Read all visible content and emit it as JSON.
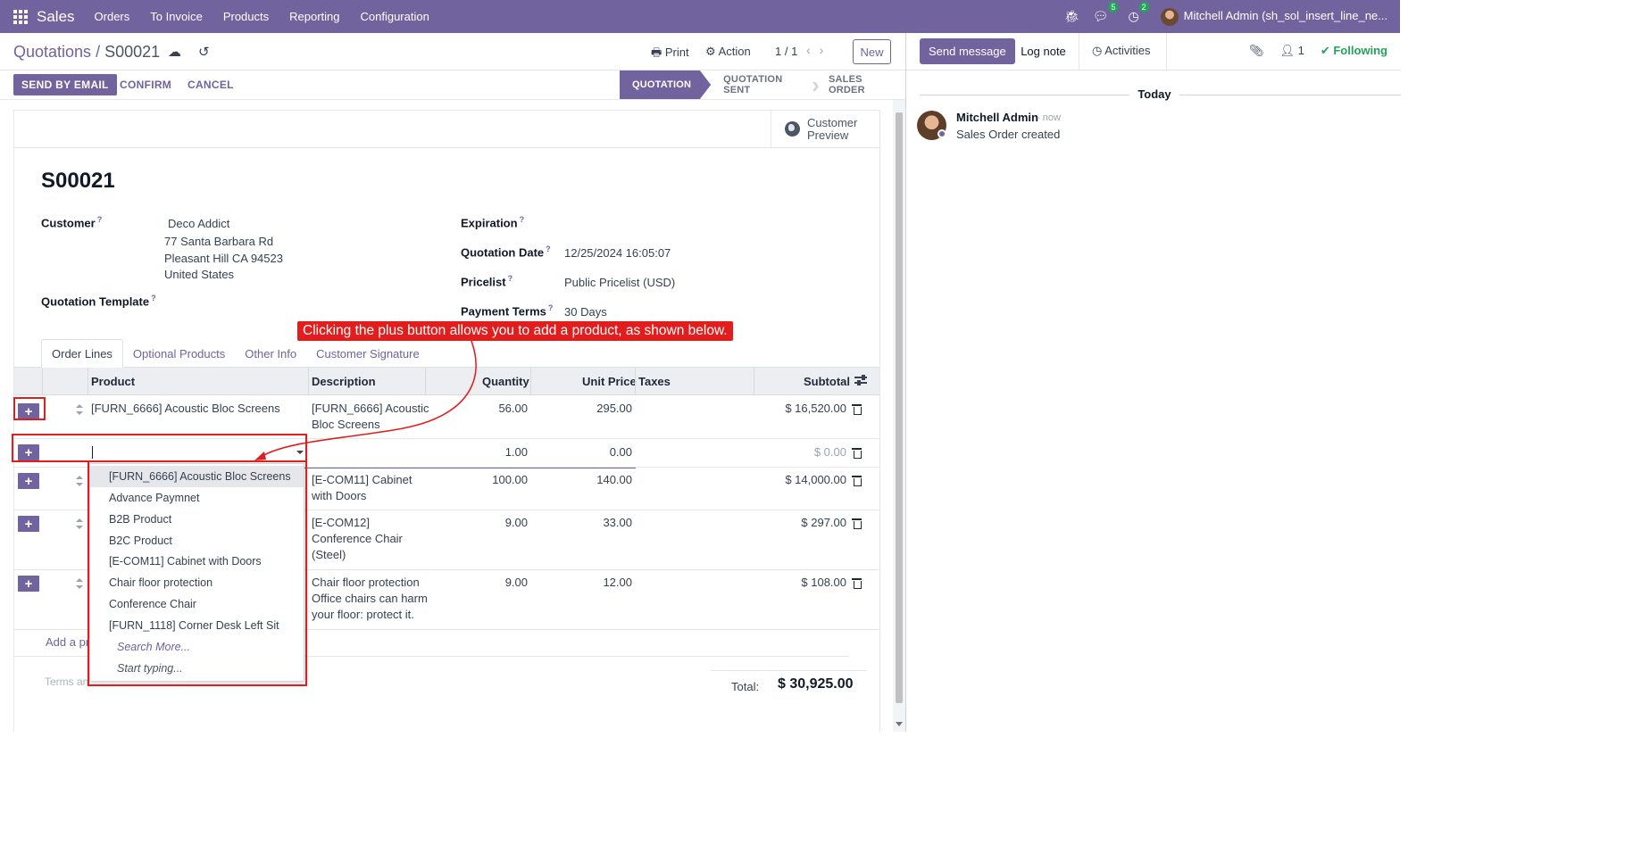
{
  "nav": {
    "brand": "Sales",
    "items": [
      "Orders",
      "To Invoice",
      "Products",
      "Reporting",
      "Configuration"
    ],
    "messages_badge": "5",
    "activities_badge": "2",
    "user": "Mitchell Admin (sh_sol_insert_line_ne..."
  },
  "control_panel": {
    "breadcrumb_parent": "Quotations",
    "breadcrumb_sep": "/",
    "breadcrumb_current": "S00021",
    "print": "Print",
    "action": "Action",
    "pager": "1 / 1",
    "new": "New"
  },
  "statusbar": {
    "send_by_email": "SEND BY EMAIL",
    "confirm": "CONFIRM",
    "cancel": "CANCEL",
    "stages": [
      "QUOTATION",
      "QUOTATION SENT",
      "SALES ORDER"
    ]
  },
  "form": {
    "customer_preview": "Customer Preview",
    "record_name": "S00021",
    "customer_label": "Customer",
    "customer_name": "Deco Addict",
    "customer_address": [
      "77 Santa Barbara Rd",
      "Pleasant Hill CA 94523",
      "United States"
    ],
    "quotation_template_label": "Quotation Template",
    "expiration_label": "Expiration",
    "quotation_date_label": "Quotation Date",
    "quotation_date": "12/25/2024 16:05:07",
    "pricelist_label": "Pricelist",
    "pricelist": "Public Pricelist (USD)",
    "payment_terms_label": "Payment Terms",
    "payment_terms": "30 Days",
    "help_marker": "?"
  },
  "tabs": [
    "Order Lines",
    "Optional Products",
    "Other Info",
    "Customer Signature"
  ],
  "table": {
    "headers": {
      "product": "Product",
      "description": "Description",
      "quantity": "Quantity",
      "unit_price": "Unit Price",
      "taxes": "Taxes",
      "subtotal": "Subtotal"
    },
    "rows": [
      {
        "product": "[FURN_6666] Acoustic Bloc Screens",
        "description": [
          "[FURN_6666] Acoustic",
          "Bloc Screens"
        ],
        "quantity": "56.00",
        "unit_price": "295.00",
        "subtotal": "$ 16,520.00"
      },
      {
        "product": "",
        "description": [],
        "quantity": "1.00",
        "unit_price": "0.00",
        "subtotal": "$ 0.00"
      },
      {
        "product": "",
        "description": [
          "[E-COM11] Cabinet",
          "with Doors"
        ],
        "quantity": "100.00",
        "unit_price": "140.00",
        "subtotal": "$ 14,000.00"
      },
      {
        "product": "",
        "description": [
          "[E-COM12]",
          "Conference Chair",
          "(Steel)"
        ],
        "quantity": "9.00",
        "unit_price": "33.00",
        "subtotal": "$ 297.00"
      },
      {
        "product": "",
        "description": [
          "Chair floor protection",
          "Office chairs can harm",
          "your floor: protect it."
        ],
        "quantity": "9.00",
        "unit_price": "12.00",
        "subtotal": "$ 108.00"
      }
    ],
    "add_line": "Add a pro",
    "plus": "+"
  },
  "dropdown": {
    "items": [
      "[FURN_6666] Acoustic Bloc Screens",
      "Advance Paymnet",
      "B2B Product",
      "B2C Product",
      "[E-COM11] Cabinet with Doors",
      "Chair floor protection",
      "Conference Chair",
      "[FURN_1118] Corner Desk Left Sit"
    ],
    "search_more": "Search More...",
    "start_typing": "Start typing..."
  },
  "footer": {
    "terms_placeholder": "Terms an",
    "total_label": "Total:",
    "total_value": "$ 30,925.00"
  },
  "annotation": {
    "callout": "Clicking the plus button allows you to add a product, as shown below.",
    "color": "#e11d1d"
  },
  "chatter": {
    "send_message": "Send message",
    "log_note": "Log note",
    "activities": "Activities",
    "followers_count": "1",
    "following": "Following",
    "today": "Today",
    "author": "Mitchell Admin",
    "time": "- now",
    "body": "Sales Order created"
  },
  "colors": {
    "brand": "#71639e",
    "success": "#22a559",
    "annotation": "#e11d1d"
  }
}
